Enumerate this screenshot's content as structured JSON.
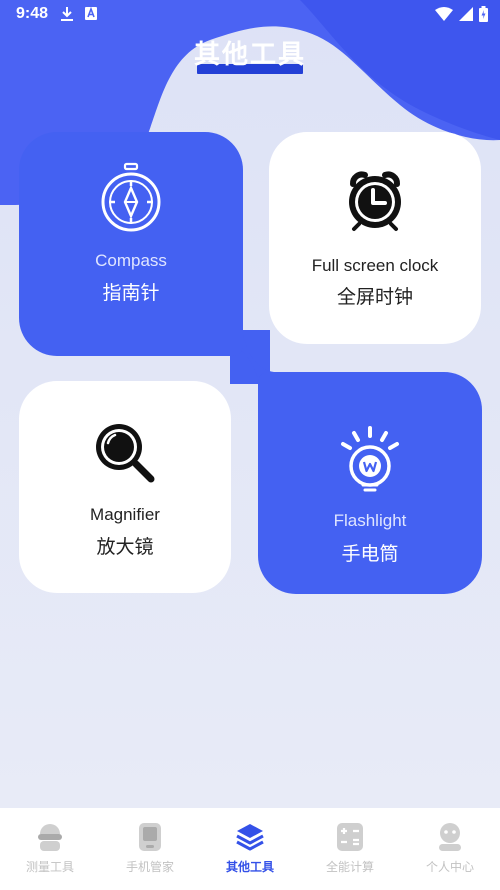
{
  "status_bar": {
    "time": "9:48",
    "icons_left": [
      "download-icon",
      "a-letter-notification-icon"
    ],
    "icons_right": [
      "wifi-icon",
      "signal-icon",
      "battery-charging-icon"
    ]
  },
  "header": {
    "title": "其他工具"
  },
  "tools": [
    {
      "id": "compass",
      "en": "Compass",
      "zh": "指南针",
      "icon": "compass-icon",
      "style": "blue"
    },
    {
      "id": "clock",
      "en": "Full screen clock",
      "zh": "全屏时钟",
      "icon": "alarm-clock-icon",
      "style": "white"
    },
    {
      "id": "magnifier",
      "en": "Magnifier",
      "zh": "放大镜",
      "icon": "magnifier-icon",
      "style": "white"
    },
    {
      "id": "flashlight",
      "en": "Flashlight",
      "zh": "手电筒",
      "icon": "lightbulb-icon",
      "style": "blue"
    }
  ],
  "bottom_nav": {
    "items": [
      {
        "label": "测量工具",
        "icon": "measure-robot-icon",
        "active": false
      },
      {
        "label": "手机管家",
        "icon": "phone-manager-icon",
        "active": false
      },
      {
        "label": "其他工具",
        "icon": "layers-icon",
        "active": true
      },
      {
        "label": "全能计算",
        "icon": "calculator-icon",
        "active": false
      },
      {
        "label": "个人中心",
        "icon": "profile-icon",
        "active": false
      }
    ]
  },
  "colors": {
    "accent": "#4461f2",
    "header_blue": "#4b63f3",
    "background": "#e6e9f6",
    "nav_active": "#3451e8",
    "nav_inactive": "#c2c2c2"
  }
}
